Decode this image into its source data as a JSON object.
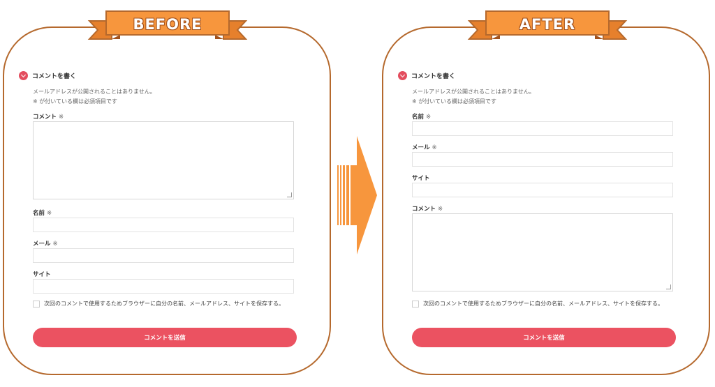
{
  "before": {
    "ribbon": "BEFORE",
    "section_title": "コメントを書く",
    "note1": "メールアドレスが公開されることはありません。",
    "note2": "※ が付いている欄は必須項目です",
    "comment_label": "コメント",
    "name_label": "名前",
    "email_label": "メール",
    "site_label": "サイト",
    "required_mark": "※",
    "save_info": "次回のコメントで使用するためブラウザーに自分の名前、メールアドレス、サイトを保存する。",
    "submit": "コメントを送信"
  },
  "after": {
    "ribbon": "AFTER",
    "section_title": "コメントを書く",
    "note1": "メールアドレスが公開されることはありません。",
    "note2": "※ が付いている欄は必須項目です",
    "name_label": "名前",
    "email_label": "メール",
    "site_label": "サイト",
    "comment_label": "コメント",
    "required_mark": "※",
    "save_info": "次回のコメントで使用するためブラウザーに自分の名前、メールアドレス、サイトを保存する。",
    "submit": "コメントを送信"
  },
  "colors": {
    "ribbon": "#f7963d",
    "ribbon_dark": "#b5692d",
    "panel_border": "#b5692d",
    "accent": "#eb5261",
    "arrow": "#f7963d"
  },
  "icons": [
    "chevron-down-icon",
    "arrow-right-icon"
  ]
}
